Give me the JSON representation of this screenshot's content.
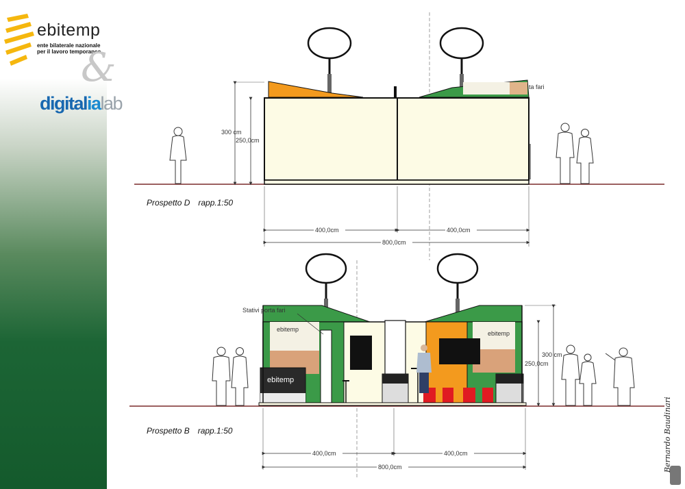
{
  "sidebar": {
    "logo_primary": "ebitemp",
    "logo_primary_sub_1": "ente bilaterale nazionale",
    "logo_primary_sub_2": "per il lavoro temporaneo",
    "ampersand": "&",
    "logo_secondary_a": "digital",
    "logo_secondary_b": "ia",
    "logo_secondary_c": "lab"
  },
  "elevation_d": {
    "caption": "Prospetto D",
    "scale": "rapp.1:50",
    "height_total": "300 cm",
    "height_panel": "250,0cm",
    "note": "ta fari",
    "width_left": "400,0cm",
    "width_right": "400,0cm",
    "width_total": "800,0cm"
  },
  "elevation_b": {
    "caption": "Prospetto B",
    "scale": "rapp.1:50",
    "note": "Stativi porta fari",
    "height_total": "300 cm",
    "height_panel": "250,0cm",
    "width_left": "400,0cm",
    "width_right": "400,0cm",
    "width_total": "800,0cm",
    "counter_brand": "ebitemp",
    "panel_brand": "ebitemp"
  },
  "signature": "Bernardo Baudinari",
  "colors": {
    "orange": "#f39a1e",
    "green": "#3b9a48",
    "panel": "#fdfbe5",
    "ground": "#7a2a2a",
    "red": "#e01b22",
    "sidebar_green": "#145a2c"
  }
}
